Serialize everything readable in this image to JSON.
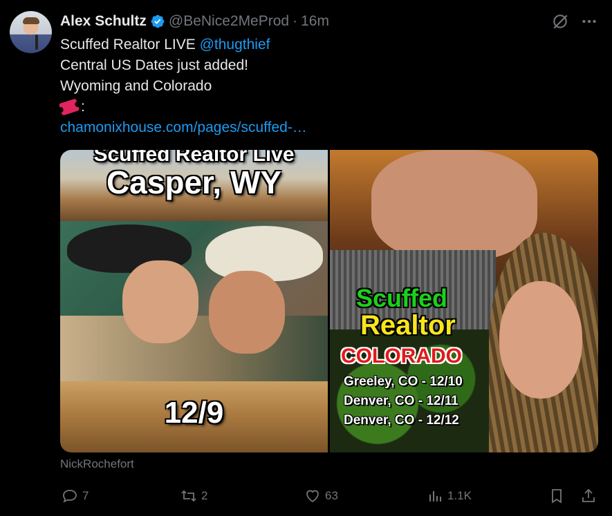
{
  "author": {
    "display_name": "Alex Schultz",
    "handle": "@BeNice2MeProd",
    "separator": "·",
    "time": "16m",
    "verified": true
  },
  "tweet": {
    "line1_text": "Scuffed Realtor LIVE ",
    "line1_mention": "@thugthief",
    "line2": "Central US Dates just added!",
    "line3": "Wyoming and Colorado",
    "line4_suffix": ":",
    "link": "chamonixhouse.com/pages/scuffed-…"
  },
  "media": {
    "left": {
      "title_small": "Scuffed Realtor Live",
      "title_big": "Casper, WY",
      "date": "12/9"
    },
    "right": {
      "brand_line1": "Scuffed",
      "brand_line2": "Realtor",
      "state": "COLORADO",
      "dates": [
        "Greeley, CO - 12/10",
        "Denver, CO - 12/11",
        "Denver, CO - 12/12"
      ]
    },
    "credit": "NickRochefort"
  },
  "actions": {
    "replies": "7",
    "retweets": "2",
    "likes": "63",
    "views": "1.1K"
  },
  "colors": {
    "background": "#000000",
    "text": "#e7e9ea",
    "muted": "#71767b",
    "link": "#1d9bf0",
    "verified": "#1d9bf0"
  },
  "icons": [
    "grok-icon",
    "more-icon",
    "verified-badge-icon",
    "ticket-emoji-icon",
    "reply-icon",
    "retweet-icon",
    "like-icon",
    "views-icon",
    "bookmark-icon",
    "share-icon"
  ]
}
